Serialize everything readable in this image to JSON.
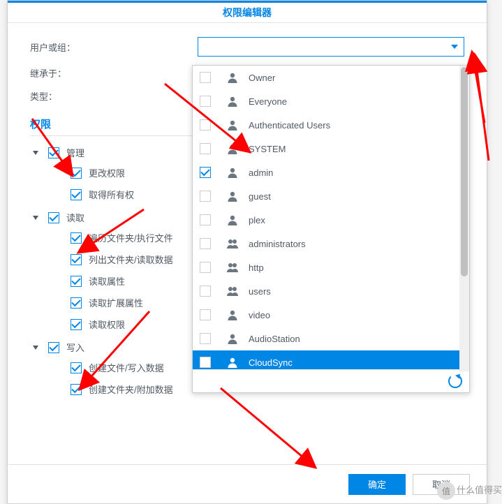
{
  "dialog": {
    "title": "权限编辑器",
    "labels": {
      "user_or_group": "用户或组：",
      "inherit_from": "继承于：",
      "type": "类型："
    },
    "select_value": ""
  },
  "permissions": {
    "section_title": "权限",
    "groups": [
      {
        "label": "管理",
        "checked": true,
        "items": [
          {
            "label": "更改权限",
            "checked": true
          },
          {
            "label": "取得所有权",
            "checked": true
          }
        ]
      },
      {
        "label": "读取",
        "checked": true,
        "items": [
          {
            "label": "遍历文件夹/执行文件",
            "checked": true
          },
          {
            "label": "列出文件夹/读取数据",
            "checked": true
          },
          {
            "label": "读取属性",
            "checked": true
          },
          {
            "label": "读取扩展属性",
            "checked": true
          },
          {
            "label": "读取权限",
            "checked": true
          }
        ]
      },
      {
        "label": "写入",
        "checked": true,
        "items": [
          {
            "label": "创建文件/写入数据",
            "checked": true
          },
          {
            "label": "创建文件夹/附加数据",
            "checked": true
          }
        ]
      }
    ]
  },
  "dropdown": {
    "items": [
      {
        "label": "Owner",
        "type": "user",
        "checked": false,
        "selected": false
      },
      {
        "label": "Everyone",
        "type": "user",
        "checked": false,
        "selected": false
      },
      {
        "label": "Authenticated Users",
        "type": "user",
        "checked": false,
        "selected": false
      },
      {
        "label": "SYSTEM",
        "type": "user",
        "checked": false,
        "selected": false
      },
      {
        "label": "admin",
        "type": "user",
        "checked": true,
        "selected": false
      },
      {
        "label": "guest",
        "type": "user",
        "checked": false,
        "selected": false
      },
      {
        "label": "plex",
        "type": "user",
        "checked": false,
        "selected": false
      },
      {
        "label": "administrators",
        "type": "group",
        "checked": false,
        "selected": false
      },
      {
        "label": "http",
        "type": "group",
        "checked": false,
        "selected": false
      },
      {
        "label": "users",
        "type": "group",
        "checked": false,
        "selected": false
      },
      {
        "label": "video",
        "type": "user",
        "checked": false,
        "selected": false
      },
      {
        "label": "AudioStation",
        "type": "user",
        "checked": false,
        "selected": false
      },
      {
        "label": "CloudSync",
        "type": "user",
        "checked": false,
        "selected": true
      }
    ]
  },
  "footer": {
    "ok": "确定",
    "cancel": "取消"
  },
  "watermark": "什么值得买",
  "watermark_badge": "值"
}
